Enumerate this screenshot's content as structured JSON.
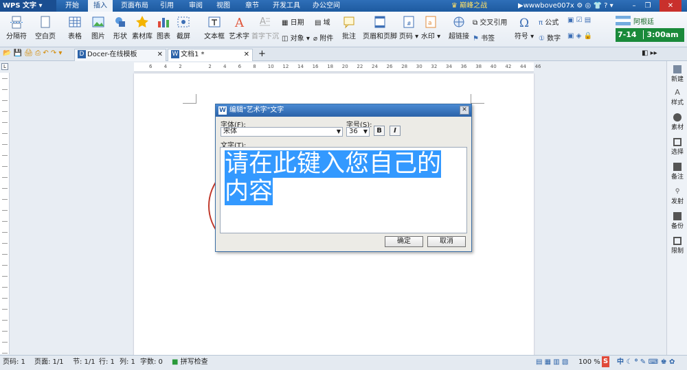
{
  "menubar": {
    "app": "WPS 文字",
    "tabs": [
      "开始",
      "插入",
      "页面布局",
      "引用",
      "审阅",
      "视图",
      "章节",
      "开发工具",
      "办公空间"
    ],
    "active": "插入",
    "promo": "巅峰之战",
    "user": "wwwbove007x"
  },
  "ribbon": {
    "items": [
      {
        "label": "分隔符",
        "icon": "page-break-icon"
      },
      {
        "label": "空白页",
        "icon": "blank-page-icon"
      },
      {
        "label": "表格",
        "icon": "table-icon"
      },
      {
        "label": "图片",
        "icon": "picture-icon"
      },
      {
        "label": "形状",
        "icon": "shape-icon"
      },
      {
        "label": "素材库",
        "icon": "star-icon"
      },
      {
        "label": "图表",
        "icon": "chart-icon"
      },
      {
        "label": "截屏",
        "icon": "screenshot-icon"
      },
      {
        "label": "文本框",
        "icon": "textbox-icon"
      },
      {
        "label": "艺术字",
        "icon": "wordart-icon"
      },
      {
        "label": "首字下沉",
        "icon": "dropcap-icon"
      },
      {
        "label": "批注",
        "icon": "comment-icon"
      },
      {
        "label": "页眉和页脚",
        "icon": "header-footer-icon"
      },
      {
        "label": "页码",
        "icon": "page-number-icon"
      },
      {
        "label": "水印",
        "icon": "watermark-icon"
      },
      {
        "label": "超链接",
        "icon": "hyperlink-icon"
      },
      {
        "label": "符号",
        "icon": "omega-icon"
      }
    ],
    "small": {
      "date": "日期",
      "field": "域",
      "object": "对象",
      "attachment": "附件",
      "crossref": "交叉引用",
      "bookmark": "书签",
      "formula": "公式",
      "number": "数字"
    },
    "clock": {
      "name": "阿根廷",
      "date": "7-14",
      "time": "3:00am"
    }
  },
  "doctabs": {
    "t1": "Docer-在线模板",
    "t2": "文档1 *"
  },
  "ruler": [
    "6",
    "4",
    "2",
    "",
    "2",
    "4",
    "6",
    "8",
    "10",
    "12",
    "14",
    "16",
    "18",
    "20",
    "22",
    "24",
    "26",
    "28",
    "30",
    "32",
    "34",
    "36",
    "38",
    "40",
    "42",
    "44",
    "46"
  ],
  "dialog": {
    "title": "编辑\"艺术字\"文字",
    "font_label": "字体(F):",
    "font_value": "宋体",
    "size_label": "字号(S):",
    "size_value": "36",
    "bold": "B",
    "italic": "I",
    "text_label": "文字(T):",
    "text_line1": "请在此键入您自己的",
    "text_line2": "内容",
    "ok": "确定",
    "cancel": "取消"
  },
  "sidebar": [
    "新建",
    "样式",
    "素材",
    "选择",
    "备注",
    "发射",
    "备份",
    "限制"
  ],
  "status": {
    "page": "页码: 1",
    "pages": "页面: 1/1",
    "section": "节: 1/1",
    "row": "行: 1",
    "col": "列: 1",
    "words": "字数: 0",
    "spell": "拼写检查",
    "zoom": "100 %",
    "ime": "中"
  }
}
